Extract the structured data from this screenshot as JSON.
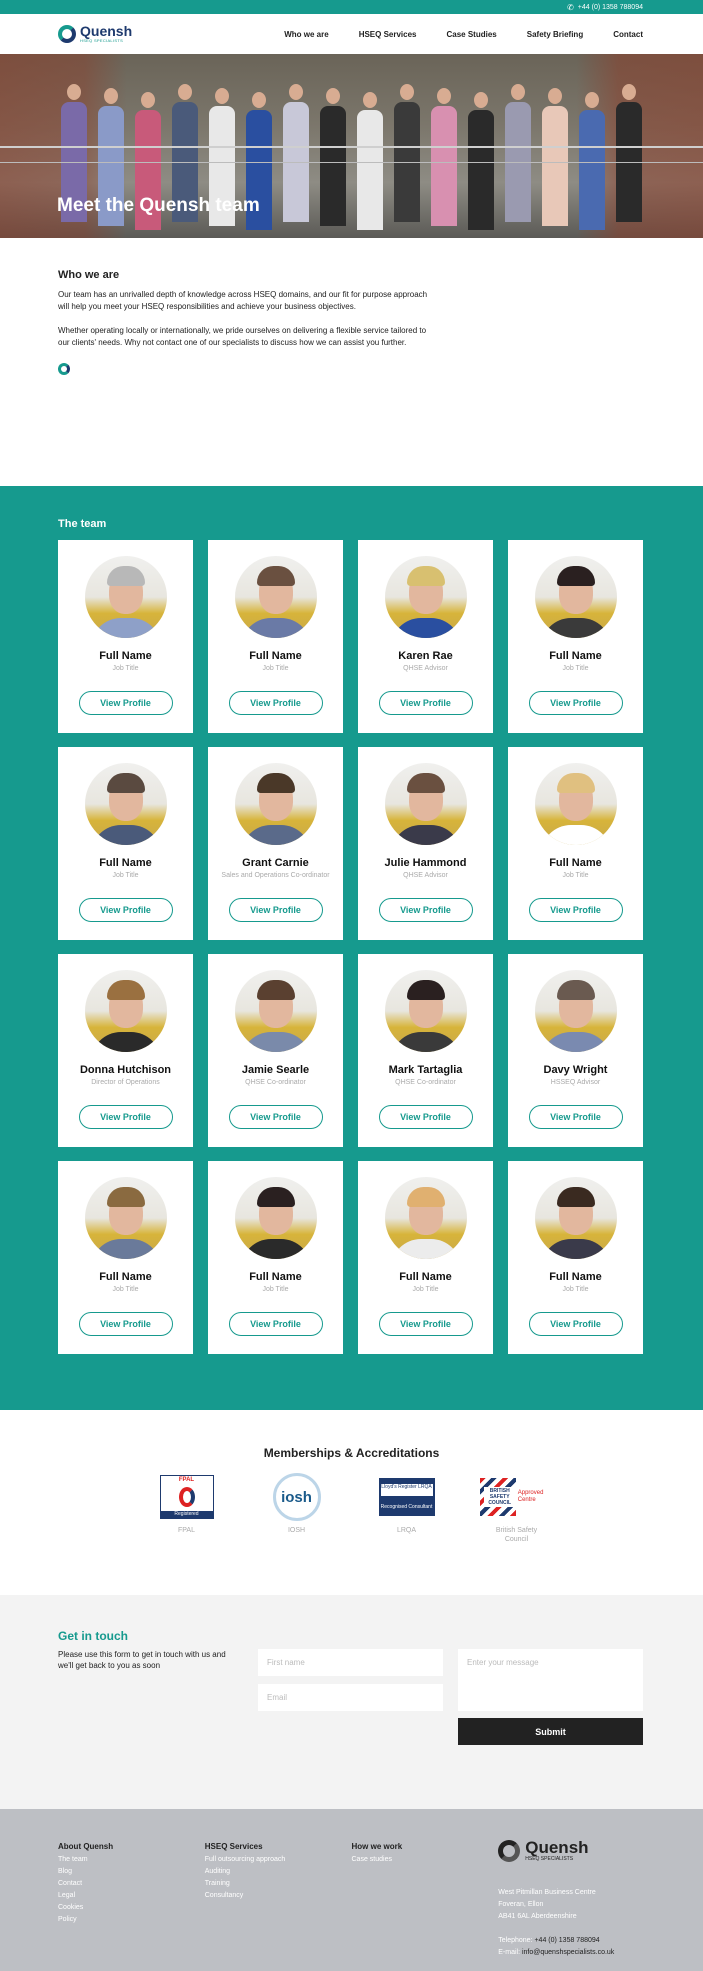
{
  "topbar": {
    "phone_icon": "phone-icon",
    "phone": "+44 (0) 1358 788094"
  },
  "header": {
    "logo_name": "Quensh",
    "logo_sub": "HSEQ SPECIALISTS",
    "nav": [
      "Who we are",
      "HSEQ Services",
      "Case Studies",
      "Safety Briefing",
      "Contact"
    ]
  },
  "hero": {
    "title": "Meet the Quensh team"
  },
  "who": {
    "heading": "Who we are",
    "p1": "Our team has an unrivalled depth of knowledge across HSEQ domains, and our fit for purpose approach will help you meet your HSEQ responsibilities and achieve your business objectives.",
    "p2": "Whether operating locally or internationally, we pride ourselves on delivering a flexible service tailored to our clients' needs.  Why not contact one of our specialists to discuss how we can assist you further."
  },
  "team": {
    "heading": "The team",
    "button_label": "View Profile",
    "members": [
      {
        "name": "Full Name",
        "title": "Job Title"
      },
      {
        "name": "Full Name",
        "title": "Job Title"
      },
      {
        "name": "Karen Rae",
        "title": "QHSE Advisor"
      },
      {
        "name": "Full Name",
        "title": "Job Title"
      },
      {
        "name": "Full Name",
        "title": "Job Title"
      },
      {
        "name": "Grant Carnie",
        "title": "Sales and Operations Co-ordinator"
      },
      {
        "name": "Julie Hammond",
        "title": "QHSE Advisor"
      },
      {
        "name": "Full Name",
        "title": "Job Title"
      },
      {
        "name": "Donna Hutchison",
        "title": "Director of Operations"
      },
      {
        "name": "Jamie Searle",
        "title": "QHSE Co-ordinator"
      },
      {
        "name": "Mark Tartaglia",
        "title": "QHSE Co-ordinator"
      },
      {
        "name": "Davy Wright",
        "title": "HSSEQ Advisor"
      },
      {
        "name": "Full Name",
        "title": "Job Title"
      },
      {
        "name": "Full Name",
        "title": "Job Title"
      },
      {
        "name": "Full Name",
        "title": "Job Title"
      },
      {
        "name": "Full Name",
        "title": "Job Title"
      }
    ]
  },
  "memberships": {
    "heading": "Memberships & Accreditations",
    "items": [
      {
        "label": "FPAL",
        "logo_top": "FPAL",
        "logo_bottom": "Registered"
      },
      {
        "label": "IOSH",
        "logo_text": "iosh"
      },
      {
        "label": "LRQA",
        "logo_text": "Lloyd's Register LRQA",
        "logo_sub": "Recognised Consultant"
      },
      {
        "label": "British Safety Council",
        "logo_text": "BRITISH SAFETY COUNCIL",
        "logo_extra": "Approved Centre"
      }
    ]
  },
  "contact": {
    "heading": "Get in touch",
    "intro": "Please use this form to get in touch with us and we'll get back to you as soon",
    "first_name_placeholder": "First name",
    "email_placeholder": "Email",
    "message_placeholder": "Enter your message",
    "submit": "Submit"
  },
  "footer": {
    "about": {
      "heading": "About Quensh",
      "links": [
        "The team",
        "Blog",
        "Contact",
        "Legal",
        "Cookies",
        "Policy"
      ]
    },
    "services": {
      "heading": "HSEQ Services",
      "links": [
        "Full outsourcing approach",
        "Auditing",
        "Training",
        "Consultancy"
      ]
    },
    "how": {
      "heading": "How we work",
      "links": [
        "Case studies"
      ]
    },
    "logo_name": "Quensh",
    "logo_sub": "HSEQ SPECIALISTS",
    "address": [
      "West Pitmillan Business Centre",
      "Foveran, Ellon",
      "AB41 6AL Aberdeenshire"
    ],
    "telephone_label": "Telephone:",
    "telephone": "+44 (0) 1358 788094",
    "email_label": "E-mail:",
    "email": "info@quenshspecialists.co.uk",
    "social": [
      "twitter-icon",
      "vimeo-icon",
      "instagram-icon",
      "linkedin-icon"
    ]
  }
}
